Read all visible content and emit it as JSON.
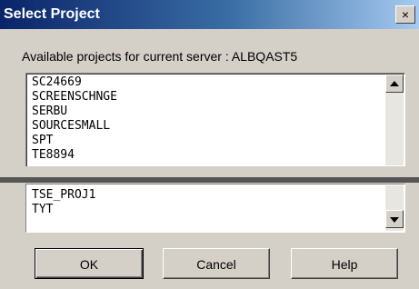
{
  "window": {
    "title": "Select Project",
    "close_glyph": "×"
  },
  "label": "Available projects for current server : ALBQAST5",
  "projects_top": [
    "SC24669",
    "SCREENSCHNGE",
    "SERBU",
    "SOURCESMALL",
    "SPT",
    "TE8894"
  ],
  "projects_bottom": [
    "TSE_PROJ1",
    "TYT"
  ],
  "buttons": {
    "ok": "OK",
    "cancel": "Cancel",
    "help": "Help"
  },
  "icons": {
    "scroll_up": "scroll-up-arrow-icon",
    "scroll_down": "scroll-down-arrow-icon"
  }
}
